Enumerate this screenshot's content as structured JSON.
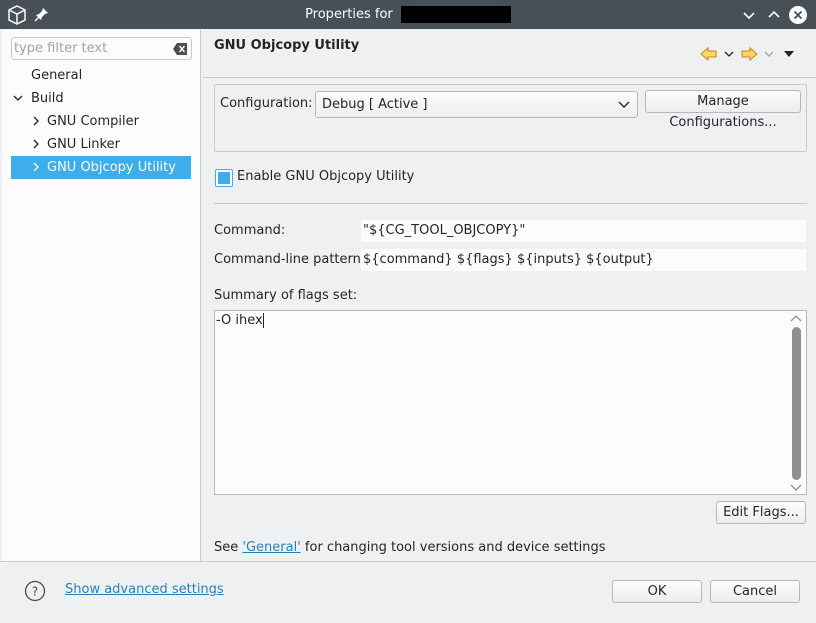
{
  "window": {
    "title": "Properties for",
    "buttons": [
      "minimize",
      "maximize",
      "close"
    ]
  },
  "sidebar": {
    "filter_placeholder": "type filter text",
    "items": [
      {
        "label": "General",
        "level": 1,
        "expandable": false,
        "selected": false
      },
      {
        "label": "Build",
        "level": 0,
        "expandable": true,
        "expanded": true,
        "selected": false
      },
      {
        "label": "GNU Compiler",
        "level": 1,
        "expandable": true,
        "expanded": false,
        "selected": false
      },
      {
        "label": "GNU Linker",
        "level": 1,
        "expandable": true,
        "expanded": false,
        "selected": false
      },
      {
        "label": "GNU Objcopy Utility",
        "level": 1,
        "expandable": true,
        "expanded": false,
        "selected": true
      }
    ]
  },
  "page": {
    "title": "GNU Objcopy Utility",
    "configuration_label": "Configuration:",
    "configuration_value": "Debug  [ Active ]",
    "manage_button": "Manage Configurations...",
    "enable_label": "Enable GNU Objcopy Utility",
    "enable_checked": true,
    "command_label": "Command:",
    "command_value": "\"${CG_TOOL_OBJCOPY}\"",
    "pattern_label": "Command-line pattern:",
    "pattern_value": "${command} ${flags} ${inputs} ${output}",
    "summary_label": "Summary of flags set:",
    "summary_value": "-O ihex",
    "edit_flags_button": "Edit Flags...",
    "hint_prefix": "See ",
    "hint_link": "'General'",
    "hint_suffix": " for changing tool versions and device settings"
  },
  "footer": {
    "advanced_link": "Show advanced settings",
    "ok_button": "OK",
    "cancel_button": "Cancel"
  },
  "colors": {
    "accent": "#3daee9",
    "titlebar": "#475057",
    "link": "#2980b9",
    "nav_arrow": "#f0a30a"
  }
}
